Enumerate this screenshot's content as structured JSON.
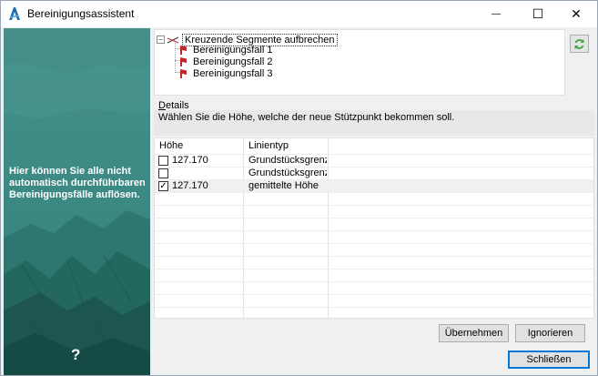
{
  "window": {
    "title": "Bereinigungsassistent",
    "minimize_glyph": "—",
    "maximize_glyph": "☐",
    "close_glyph": "✕"
  },
  "side_panel": {
    "message": "Hier können Sie alle nicht automatisch durchführbaren Bereinigungsfälle auflösen.",
    "help_glyph": "?"
  },
  "tree": {
    "root_label": "Kreuzende Segmente aufbrechen",
    "expander_glyph": "−",
    "children": [
      {
        "label": "Bereinigungsfall 1"
      },
      {
        "label": "Bereinigungsfall 2"
      },
      {
        "label": "Bereinigungsfall 3"
      }
    ]
  },
  "details": {
    "label_underlined": "D",
    "label_rest": "etails",
    "text": "Wählen Sie die Höhe, welche der neue Stützpunkt bekommen soll."
  },
  "grid": {
    "columns": [
      "Höhe",
      "Linientyp"
    ],
    "rows": [
      {
        "checked": false,
        "hoehe": "127.170",
        "linientyp": "Grundstücksgrenz..."
      },
      {
        "checked": false,
        "hoehe": "",
        "linientyp": "Grundstücksgrenz..."
      },
      {
        "checked": true,
        "hoehe": "127.170",
        "linientyp": "gemittelte Höhe"
      }
    ],
    "check_glyph": "✓"
  },
  "buttons": {
    "apply": "Übernehmen",
    "ignore": "Ignorieren",
    "close": "Schließen"
  },
  "colors": {
    "side_panel": "#3a8a83",
    "flag": "#c0262c",
    "refresh": "#3aa53a",
    "default_button_border": "#0078d7"
  }
}
